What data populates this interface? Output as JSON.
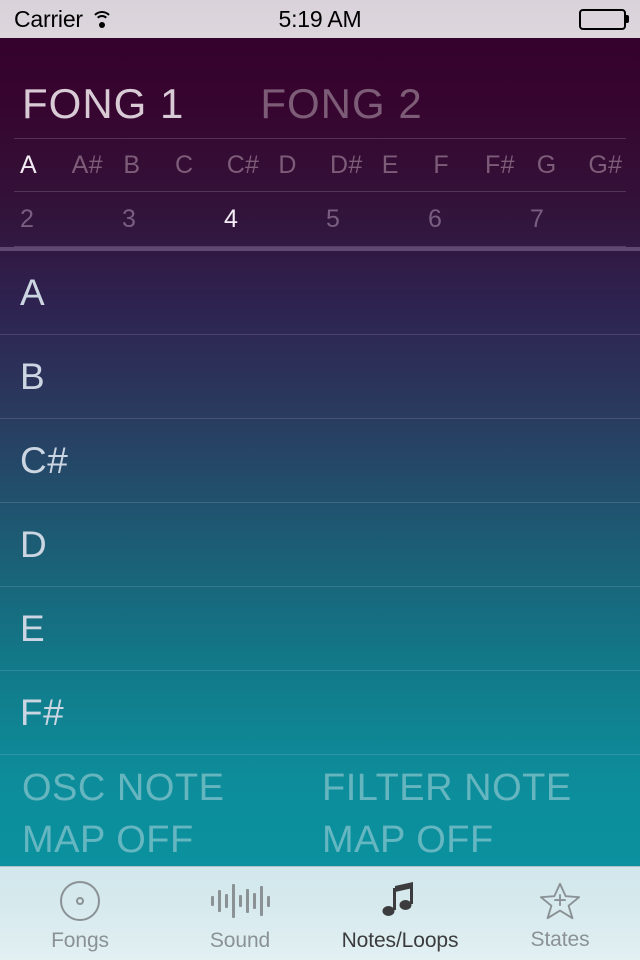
{
  "status_bar": {
    "carrier": "Carrier",
    "wifi_icon": "wifi-icon",
    "time": "5:19 AM",
    "battery_icon": "battery-full-icon"
  },
  "header": {
    "fongs": [
      {
        "label": "FONG 1",
        "selected": true
      },
      {
        "label": "FONG 2",
        "selected": false
      }
    ],
    "notes": [
      {
        "label": "A",
        "selected": true
      },
      {
        "label": "A#",
        "selected": false
      },
      {
        "label": "B",
        "selected": false
      },
      {
        "label": "C",
        "selected": false
      },
      {
        "label": "C#",
        "selected": false
      },
      {
        "label": "D",
        "selected": false
      },
      {
        "label": "D#",
        "selected": false
      },
      {
        "label": "E",
        "selected": false
      },
      {
        "label": "F",
        "selected": false
      },
      {
        "label": "F#",
        "selected": false
      },
      {
        "label": "G",
        "selected": false
      },
      {
        "label": "G#",
        "selected": false
      }
    ],
    "octaves": [
      {
        "label": "2",
        "selected": false
      },
      {
        "label": "3",
        "selected": false
      },
      {
        "label": "4",
        "selected": true
      },
      {
        "label": "5",
        "selected": false
      },
      {
        "label": "6",
        "selected": false
      },
      {
        "label": "7",
        "selected": false
      }
    ]
  },
  "note_list": [
    {
      "label": "A"
    },
    {
      "label": "B"
    },
    {
      "label": "C#"
    },
    {
      "label": "D"
    },
    {
      "label": "E"
    },
    {
      "label": "F#"
    }
  ],
  "map_footer": {
    "osc": {
      "title": "OSC NOTE",
      "value": "MAP OFF"
    },
    "filter": {
      "title": "FILTER NOTE",
      "value": "MAP OFF"
    }
  },
  "tab_bar": {
    "tabs": [
      {
        "label": "Fongs",
        "icon": "disc-icon",
        "active": false
      },
      {
        "label": "Sound",
        "icon": "waveform-icon",
        "active": false
      },
      {
        "label": "Notes/Loops",
        "icon": "music-note-icon",
        "active": true
      },
      {
        "label": "States",
        "icon": "star-plus-icon",
        "active": false
      }
    ]
  },
  "colors": {
    "gradient_top": "#34022c",
    "gradient_bottom": "#0b919f",
    "status_bar_bg": "#dbd4db",
    "tab_bar_bg": "#d7eaee",
    "tab_active_text": "#3c3c3e",
    "tab_inactive_text": "#8b9295",
    "selected_text": "#f2eaf2",
    "dim_text": "#7d5c79"
  }
}
